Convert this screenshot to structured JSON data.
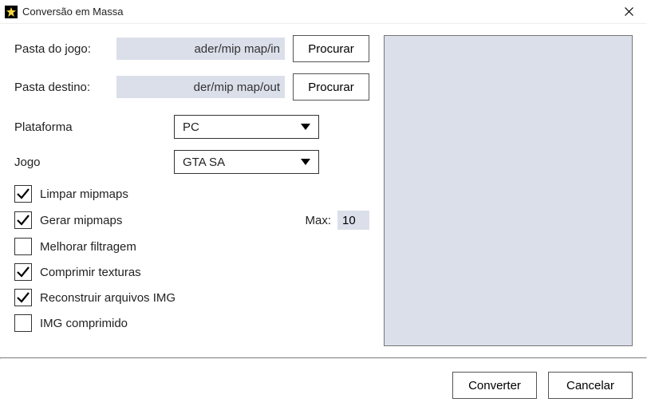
{
  "window": {
    "title": "Conversão em Massa"
  },
  "labels": {
    "game_folder": "Pasta do jogo:",
    "dest_folder": "Pasta destino:",
    "platform": "Plataforma",
    "game": "Jogo",
    "max": "Max:"
  },
  "inputs": {
    "game_folder": "ader/mip map/in",
    "dest_folder": "der/mip map/out",
    "max_mipmaps": "10"
  },
  "buttons": {
    "browse1": "Procurar",
    "browse2": "Procurar",
    "convert": "Converter",
    "cancel": "Cancelar"
  },
  "selects": {
    "platform": "PC",
    "game": "GTA SA"
  },
  "checkboxes": {
    "clear_mipmaps": {
      "label": "Limpar mipmaps",
      "checked": true
    },
    "gen_mipmaps": {
      "label": "Gerar mipmaps",
      "checked": true
    },
    "improve_filtering": {
      "label": "Melhorar filtragem",
      "checked": false
    },
    "compress_textures": {
      "label": "Comprimir texturas",
      "checked": true
    },
    "rebuild_img": {
      "label": "Reconstruir arquivos IMG",
      "checked": true
    },
    "compressed_img": {
      "label": "IMG comprimido",
      "checked": false
    }
  }
}
